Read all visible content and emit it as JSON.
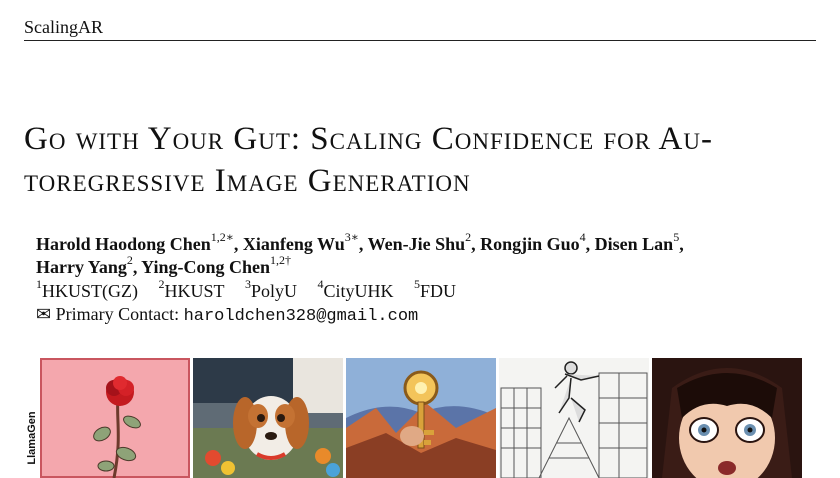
{
  "header": {
    "running_head": "ScalingAR"
  },
  "title": {
    "line1": "Go with Your Gut: Scaling Confidence for Au-",
    "line2": "toregressive Image Generation"
  },
  "authors": {
    "line1": [
      {
        "name": "Harold Haodong Chen",
        "sup": "1,2∗",
        "sep": ", "
      },
      {
        "name": "Xianfeng Wu",
        "sup": "3∗",
        "sep": ", "
      },
      {
        "name": "Wen-Jie Shu",
        "sup": "2",
        "sep": ", "
      },
      {
        "name": "Rongjin Guo",
        "sup": "4",
        "sep": ", "
      },
      {
        "name": "Disen Lan",
        "sup": "5",
        "sep": ","
      }
    ],
    "line2": [
      {
        "name": "Harry Yang",
        "sup": "2",
        "sep": ", "
      },
      {
        "name": "Ying-Cong Chen",
        "sup": "1,2†",
        "sep": ""
      }
    ]
  },
  "affiliations": [
    {
      "sup": "1",
      "name": "HKUST(GZ)"
    },
    {
      "sup": "2",
      "name": "HKUST"
    },
    {
      "sup": "3",
      "name": "PolyU"
    },
    {
      "sup": "4",
      "name": "CityUHK"
    },
    {
      "sup": "5",
      "name": "FDU"
    }
  ],
  "contact": {
    "icon": "envelope-icon",
    "symbol": "✉",
    "label": "Primary Contact:",
    "email": "haroldchen328@gmail.com"
  },
  "figure": {
    "row_label": "LlamaGen",
    "images": [
      "rose-image",
      "dog-image",
      "key-image",
      "sketch-image",
      "anime-image"
    ]
  }
}
